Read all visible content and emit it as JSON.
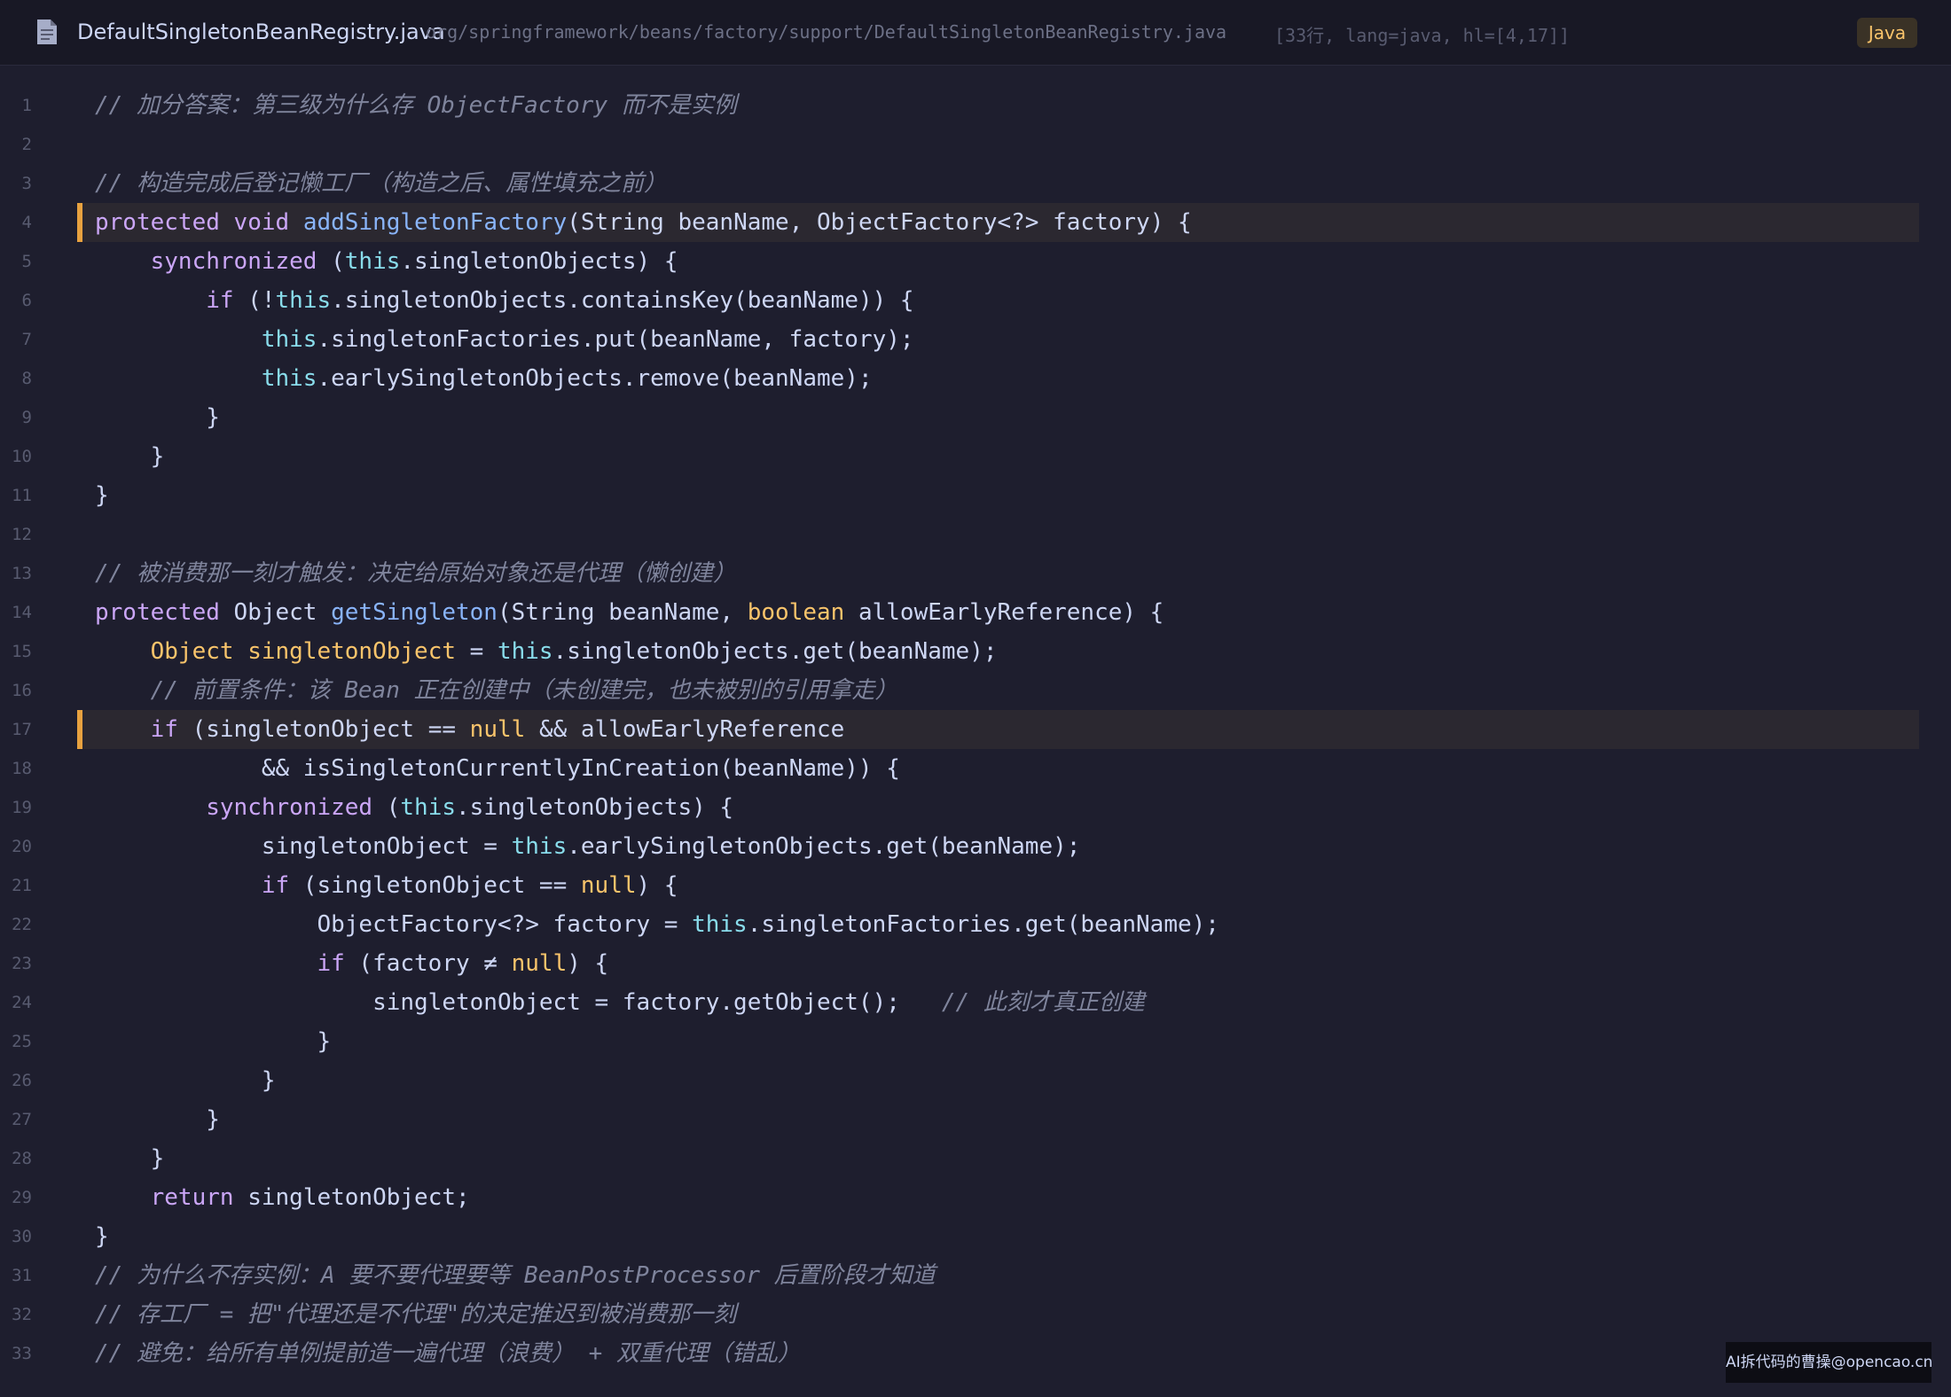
{
  "header": {
    "file_icon": "document-icon",
    "file_name": "DefaultSingletonBeanRegistry.java",
    "file_path": "org/springframework/beans/factory/support/DefaultSingletonBeanRegistry.java",
    "meta": "[33行, lang=java, hl=[4,17]]",
    "language_badge": "Java"
  },
  "colors": {
    "background": "#1e1e2e",
    "keyword": "#cba6f7",
    "this_keyword": "#89dceb",
    "function": "#89b4fa",
    "literal": "#f9c46b",
    "comment": "#7f849c",
    "highlight_bar": "#e8a23f"
  },
  "highlighted_lines": [
    4,
    17
  ],
  "code_lines": [
    [
      {
        "t": "cm",
        "s": "// 加分答案：第三级为什么存 ObjectFactory 而不是实例"
      }
    ],
    [],
    [
      {
        "t": "cm",
        "s": "// 构造完成后登记懒工厂（构造之后、属性填充之前）"
      }
    ],
    [
      {
        "t": "kw",
        "s": "protected"
      },
      {
        "t": "tx",
        "s": " "
      },
      {
        "t": "kw",
        "s": "void"
      },
      {
        "t": "tx",
        "s": " "
      },
      {
        "t": "fn",
        "s": "addSingletonFactory"
      },
      {
        "t": "tx",
        "s": "(String beanName, ObjectFactory<?> factory) {"
      }
    ],
    [
      {
        "t": "tx",
        "s": "    "
      },
      {
        "t": "kw",
        "s": "synchronized"
      },
      {
        "t": "tx",
        "s": " ("
      },
      {
        "t": "kw2",
        "s": "this"
      },
      {
        "t": "tx",
        "s": ".singletonObjects) {"
      }
    ],
    [
      {
        "t": "tx",
        "s": "        "
      },
      {
        "t": "kw",
        "s": "if"
      },
      {
        "t": "tx",
        "s": " (!"
      },
      {
        "t": "kw2",
        "s": "this"
      },
      {
        "t": "tx",
        "s": ".singletonObjects.containsKey(beanName)) {"
      }
    ],
    [
      {
        "t": "tx",
        "s": "            "
      },
      {
        "t": "kw2",
        "s": "this"
      },
      {
        "t": "tx",
        "s": ".singletonFactories.put(beanName, factory);"
      }
    ],
    [
      {
        "t": "tx",
        "s": "            "
      },
      {
        "t": "kw2",
        "s": "this"
      },
      {
        "t": "tx",
        "s": ".earlySingletonObjects.remove(beanName);"
      }
    ],
    [
      {
        "t": "tx",
        "s": "        }"
      }
    ],
    [
      {
        "t": "tx",
        "s": "    }"
      }
    ],
    [
      {
        "t": "tx",
        "s": "}"
      }
    ],
    [],
    [
      {
        "t": "cm",
        "s": "// 被消费那一刻才触发：决定给原始对象还是代理（懒创建）"
      }
    ],
    [
      {
        "t": "kw",
        "s": "protected"
      },
      {
        "t": "tx",
        "s": " Object "
      },
      {
        "t": "fn",
        "s": "getSingleton"
      },
      {
        "t": "tx",
        "s": "(String beanName, "
      },
      {
        "t": "lit",
        "s": "boolean"
      },
      {
        "t": "tx",
        "s": " allowEarlyReference) {"
      }
    ],
    [
      {
        "t": "tx",
        "s": "    "
      },
      {
        "t": "var",
        "s": "Object singletonObject"
      },
      {
        "t": "tx",
        "s": " = "
      },
      {
        "t": "kw2",
        "s": "this"
      },
      {
        "t": "tx",
        "s": ".singletonObjects.get(beanName);"
      }
    ],
    [
      {
        "t": "tx",
        "s": "    "
      },
      {
        "t": "cm",
        "s": "// 前置条件：该 Bean 正在创建中（未创建完，也未被别的引用拿走）"
      }
    ],
    [
      {
        "t": "tx",
        "s": "    "
      },
      {
        "t": "kw",
        "s": "if"
      },
      {
        "t": "tx",
        "s": " (singletonObject == "
      },
      {
        "t": "lit",
        "s": "null"
      },
      {
        "t": "tx",
        "s": " && allowEarlyReference"
      }
    ],
    [
      {
        "t": "tx",
        "s": "            && isSingletonCurrentlyInCreation(beanName)) {"
      }
    ],
    [
      {
        "t": "tx",
        "s": "        "
      },
      {
        "t": "kw",
        "s": "synchronized"
      },
      {
        "t": "tx",
        "s": " ("
      },
      {
        "t": "kw2",
        "s": "this"
      },
      {
        "t": "tx",
        "s": ".singletonObjects) {"
      }
    ],
    [
      {
        "t": "tx",
        "s": "            singletonObject = "
      },
      {
        "t": "kw2",
        "s": "this"
      },
      {
        "t": "tx",
        "s": ".earlySingletonObjects.get(beanName);"
      }
    ],
    [
      {
        "t": "tx",
        "s": "            "
      },
      {
        "t": "kw",
        "s": "if"
      },
      {
        "t": "tx",
        "s": " (singletonObject == "
      },
      {
        "t": "lit",
        "s": "null"
      },
      {
        "t": "tx",
        "s": ") {"
      }
    ],
    [
      {
        "t": "tx",
        "s": "                ObjectFactory<?> factory = "
      },
      {
        "t": "kw2",
        "s": "this"
      },
      {
        "t": "tx",
        "s": ".singletonFactories.get(beanName);"
      }
    ],
    [
      {
        "t": "tx",
        "s": "                "
      },
      {
        "t": "kw",
        "s": "if"
      },
      {
        "t": "tx",
        "s": " (factory ≠ "
      },
      {
        "t": "lit",
        "s": "null"
      },
      {
        "t": "tx",
        "s": ") {"
      }
    ],
    [
      {
        "t": "tx",
        "s": "                    singletonObject = factory.getObject();   "
      },
      {
        "t": "cm",
        "s": "// 此刻才真正创建"
      }
    ],
    [
      {
        "t": "tx",
        "s": "                }"
      }
    ],
    [
      {
        "t": "tx",
        "s": "            }"
      }
    ],
    [
      {
        "t": "tx",
        "s": "        }"
      }
    ],
    [
      {
        "t": "tx",
        "s": "    }"
      }
    ],
    [
      {
        "t": "tx",
        "s": "    "
      },
      {
        "t": "kw",
        "s": "return"
      },
      {
        "t": "tx",
        "s": " singletonObject;"
      }
    ],
    [
      {
        "t": "tx",
        "s": "}"
      }
    ],
    [
      {
        "t": "cm",
        "s": "// 为什么不存实例：A 要不要代理要等 BeanPostProcessor 后置阶段才知道"
      }
    ],
    [
      {
        "t": "cm",
        "s": "// 存工厂 = 把\"代理还是不代理\"的决定推迟到被消费那一刻"
      }
    ],
    [
      {
        "t": "cm",
        "s": "// 避免：给所有单例提前造一遍代理（浪费） + 双重代理（错乱）"
      }
    ]
  ],
  "watermark": "AI拆代码的曹操@opencao.cn"
}
